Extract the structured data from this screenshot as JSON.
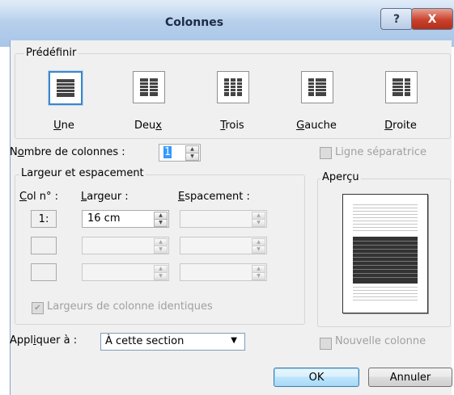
{
  "window": {
    "title": "Colonnes",
    "help_label": "?",
    "close_label": "X"
  },
  "presets": {
    "group_label": "Prédéfinir",
    "items": [
      {
        "label_pre": "",
        "label_key": "U",
        "label_post": "ne",
        "selected": true
      },
      {
        "label_pre": "Deu",
        "label_key": "x",
        "label_post": "",
        "selected": false
      },
      {
        "label_pre": "",
        "label_key": "T",
        "label_post": "rois",
        "selected": false
      },
      {
        "label_pre": "",
        "label_key": "G",
        "label_post": "auche",
        "selected": false
      },
      {
        "label_pre": "",
        "label_key": "D",
        "label_post": "roite",
        "selected": false
      }
    ]
  },
  "num_columns": {
    "label_pre": "N",
    "label_key": "o",
    "label_post": "mbre de colonnes :",
    "value": "1"
  },
  "separator": {
    "label": "Ligne séparatrice",
    "checked": false,
    "enabled": false
  },
  "width_spacing": {
    "group_label": "Largeur et espacement",
    "headers": {
      "col_key": "C",
      "col_post": "ol n° :",
      "width_key": "L",
      "width_post": "argeur :",
      "spacing_key": "E",
      "spacing_post": "spacement :"
    },
    "rows": [
      {
        "col": "1:",
        "width": "16 cm",
        "spacing": ""
      },
      {
        "col": "",
        "width": "",
        "spacing": ""
      },
      {
        "col": "",
        "width": "",
        "spacing": ""
      }
    ],
    "equal_widths": {
      "label": "Largeurs de colonne identiques",
      "checked": true,
      "enabled": false
    }
  },
  "preview": {
    "group_label": "Aperçu"
  },
  "apply_to": {
    "label_pre": "Appl",
    "label_key": "i",
    "label_post": "quer à :",
    "value": "À cette section"
  },
  "new_column": {
    "label": "Nouvelle colonne",
    "checked": false,
    "enabled": false
  },
  "buttons": {
    "ok": "OK",
    "cancel": "Annuler"
  }
}
